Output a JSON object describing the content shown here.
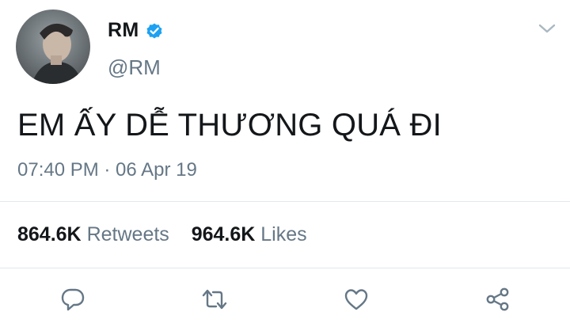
{
  "user": {
    "display_name": "RM",
    "handle": "@RM",
    "verified": true,
    "avatar_icon": "profile-photo"
  },
  "tweet": {
    "text": "EM ẤY DỄ THƯƠNG QUÁ ĐI",
    "timestamp": "07:40 PM · 06 Apr 19"
  },
  "stats": {
    "retweets_count": "864.6K",
    "retweets_label": "Retweets",
    "likes_count": "964.6K",
    "likes_label": "Likes"
  },
  "actions": [
    {
      "name": "reply",
      "icon": "reply-icon"
    },
    {
      "name": "retweet",
      "icon": "retweet-icon"
    },
    {
      "name": "like",
      "icon": "heart-icon"
    },
    {
      "name": "share",
      "icon": "share-icon"
    }
  ],
  "colors": {
    "text": "#14171a",
    "secondary": "#657786",
    "verified": "#1da1f2",
    "divider": "#e1e8ed"
  }
}
